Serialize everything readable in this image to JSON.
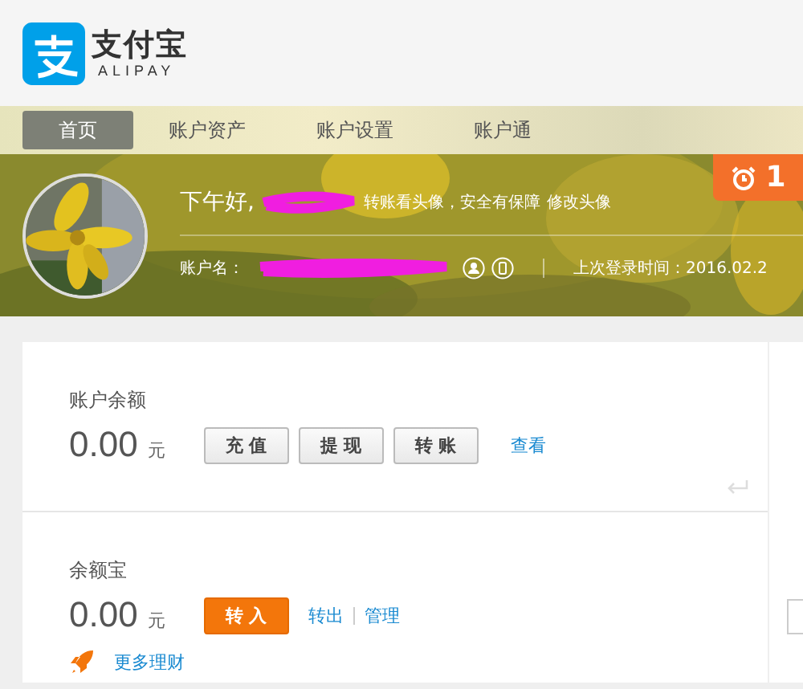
{
  "logo": {
    "name": "支付宝",
    "subtitle": "ALIPAY"
  },
  "nav": [
    {
      "label": "首页",
      "selected": true
    },
    {
      "label": "账户资产",
      "selected": false
    },
    {
      "label": "账户设置",
      "selected": false
    },
    {
      "label": "账户通",
      "selected": false
    }
  ],
  "alarm": {
    "count": "1"
  },
  "profile": {
    "greeting": "下午好,",
    "notice": "转账看头像，安全有保障",
    "edit_link": "修改头像",
    "account_label": "账户名：",
    "last_login": "上次登录时间：2016.02.2"
  },
  "balance": {
    "title": "账户余额",
    "amount": "0.00",
    "unit": "元",
    "buttons": [
      "充 值",
      "提 现",
      "转 账"
    ],
    "link": "查看"
  },
  "yuebao": {
    "title": "余额宝",
    "amount": "0.00",
    "unit": "元",
    "primary_button": "转 入",
    "links": [
      "转出",
      "管理"
    ],
    "more": "更多理财"
  }
}
